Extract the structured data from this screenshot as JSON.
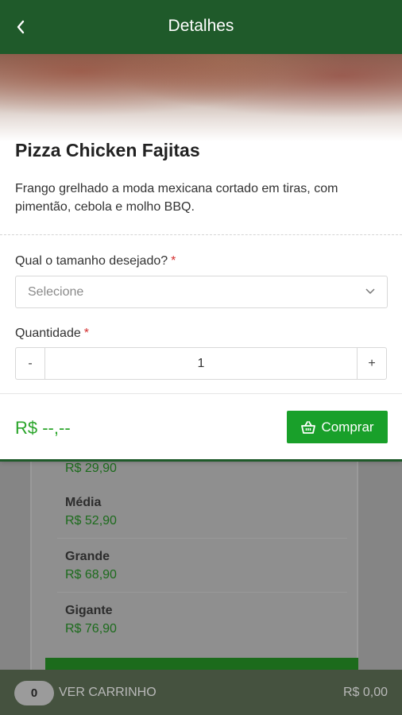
{
  "header": {
    "title": "Detalhes"
  },
  "product": {
    "name": "Pizza Chicken Fajitas",
    "description": "Frango grelhado a moda mexicana cortado em tiras, com pimentão, cebola e molho BBQ."
  },
  "form": {
    "size_label": "Qual o tamanho desejado?",
    "required_mark": "*",
    "size_placeholder": "Selecione",
    "quantity_label": "Quantidade",
    "quantity_minus": "-",
    "quantity_value": "1",
    "quantity_plus": "+"
  },
  "footer": {
    "price": "R$ --,--",
    "buy_label": "Comprar"
  },
  "background_list": {
    "first_price": "R$ 29,90",
    "items": [
      {
        "name": "Média",
        "price": "R$ 52,90"
      },
      {
        "name": "Grande",
        "price": "R$ 68,90"
      },
      {
        "name": "Gigante",
        "price": "R$ 76,90"
      }
    ]
  },
  "cart": {
    "count": "0",
    "label": "VER CARRINHO",
    "total": "R$ 0,00"
  },
  "colors": {
    "header": "#1f5a2a",
    "accent_green": "#19a02a",
    "required": "#d32f2f"
  },
  "icons": {
    "back": "chevron-left-icon",
    "dropdown": "chevron-down-icon",
    "buy": "basket-icon"
  }
}
